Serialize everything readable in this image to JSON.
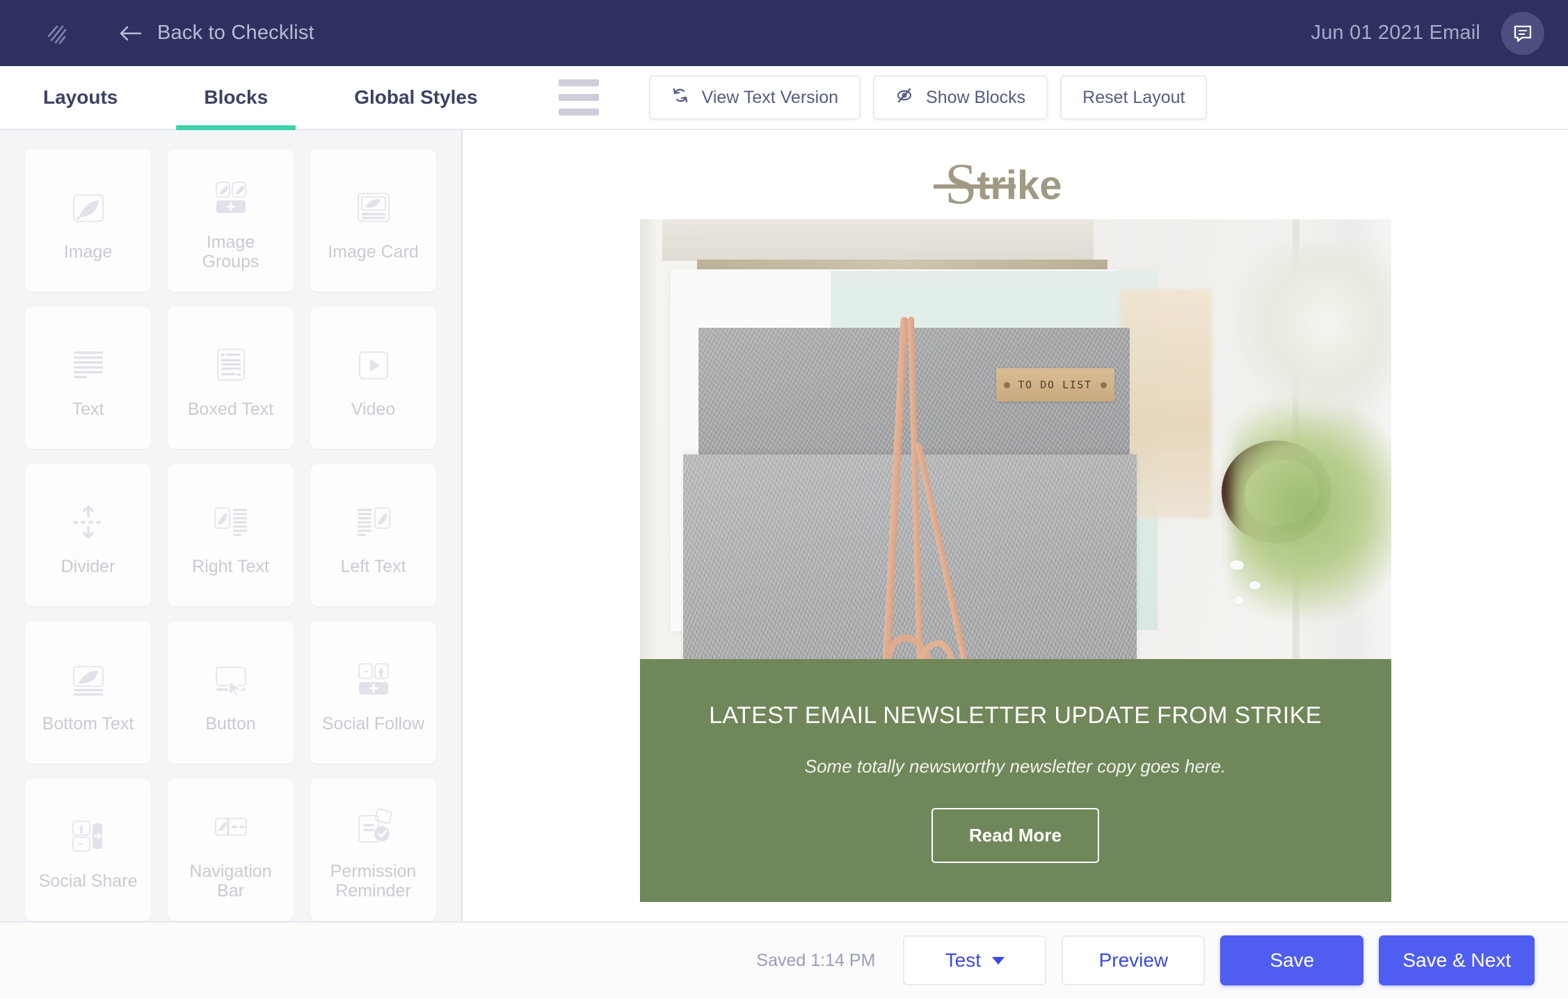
{
  "topbar": {
    "brand_icon": "strike-logo-icon",
    "back_label": "Back to Checklist",
    "back_icon": "arrow-left-icon",
    "email_name": "Jun 01 2021 Email",
    "chat_icon": "chat-bubble-icon",
    "bg_color": "#2e3060"
  },
  "tabbar": {
    "tabs": [
      {
        "label": "Layouts",
        "active": false
      },
      {
        "label": "Blocks",
        "active": true
      },
      {
        "label": "Global Styles",
        "active": false
      }
    ],
    "active_underline_color": "#3ed2a8",
    "menu_icon": "hamburger-menu-icon",
    "tools": [
      {
        "label": "View Text Version",
        "icon": "refresh-sync-icon"
      },
      {
        "label": "Show Blocks",
        "icon": "eye-off-icon"
      },
      {
        "label": "Reset Layout",
        "icon": ""
      }
    ]
  },
  "blocks_panel": {
    "items": [
      {
        "label": "Image",
        "icon": "image-leaf-icon"
      },
      {
        "label": "Image Groups",
        "icon": "image-groups-icon"
      },
      {
        "label": "Image Card",
        "icon": "image-card-icon"
      },
      {
        "label": "Text",
        "icon": "text-lines-icon"
      },
      {
        "label": "Boxed Text",
        "icon": "boxed-text-icon"
      },
      {
        "label": "Video",
        "icon": "video-play-icon"
      },
      {
        "label": "Divider",
        "icon": "divider-arrows-icon"
      },
      {
        "label": "Right Text",
        "icon": "right-text-icon"
      },
      {
        "label": "Left Text",
        "icon": "left-text-icon"
      },
      {
        "label": "Bottom Text",
        "icon": "bottom-text-icon"
      },
      {
        "label": "Button",
        "icon": "button-cursor-icon"
      },
      {
        "label": "Social Follow",
        "icon": "social-follow-icon"
      },
      {
        "label": "Social Share",
        "icon": "social-share-icon"
      },
      {
        "label": "Navigation Bar",
        "icon": "navigation-bar-icon"
      },
      {
        "label": "Permission Reminder",
        "icon": "permission-reminder-icon"
      }
    ]
  },
  "preview": {
    "logo_text": "Strike",
    "logo_color": "#a09a85",
    "hero_image_alt": "grey felt folder with leather TO DO LIST tag on desk",
    "hero_tag_text": "TO DO LIST",
    "green_block": {
      "bg_color": "#708759",
      "title": "LATEST EMAIL NEWSLETTER UPDATE FROM STRIKE",
      "subtitle": "Some totally newsworthy newsletter copy goes here.",
      "button_label": "Read More"
    }
  },
  "footer": {
    "saved_text": "Saved 1:14 PM",
    "test_label": "Test",
    "preview_label": "Preview",
    "save_label": "Save",
    "save_next_label": "Save & Next",
    "primary_color": "#4f5ef0"
  }
}
